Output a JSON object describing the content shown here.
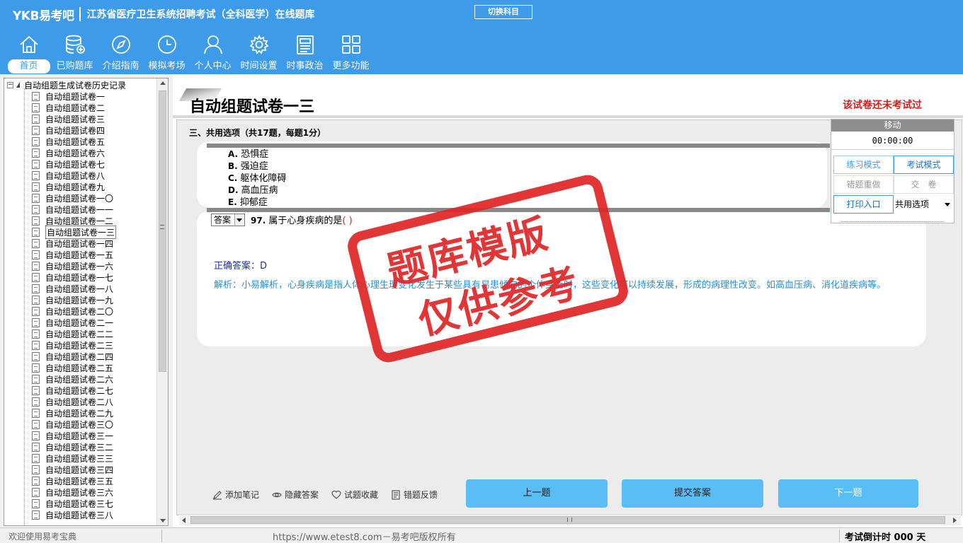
{
  "header": {
    "logo": "YKB易考吧",
    "title": "江苏省医疗卫生系统招聘考试（全科医学）在线题库",
    "switch_subject": "切换科目"
  },
  "nav": [
    {
      "label": "首页",
      "icon": "home-icon"
    },
    {
      "label": "已购题库",
      "icon": "database-icon"
    },
    {
      "label": "介绍指南",
      "icon": "compass-icon"
    },
    {
      "label": "模拟考场",
      "icon": "clock-icon"
    },
    {
      "label": "个人中心",
      "icon": "user-icon"
    },
    {
      "label": "时间设置",
      "icon": "gear-icon"
    },
    {
      "label": "时事政治",
      "icon": "news-icon"
    },
    {
      "label": "更多功能",
      "icon": "grid-icon"
    }
  ],
  "tree": {
    "root": "自动组题生成试卷历史记录",
    "items": [
      "自动组题试卷一",
      "自动组题试卷二",
      "自动组题试卷三",
      "自动组题试卷四",
      "自动组题试卷五",
      "自动组题试卷六",
      "自动组题试卷七",
      "自动组题试卷八",
      "自动组题试卷九",
      "自动组题试卷一〇",
      "自动组题试卷一一",
      "自动组题试卷一二",
      "自动组题试卷一三",
      "自动组题试卷一四",
      "自动组题试卷一五",
      "自动组题试卷一六",
      "自动组题试卷一七",
      "自动组题试卷一八",
      "自动组题试卷一九",
      "自动组题试卷二〇",
      "自动组题试卷二一",
      "自动组题试卷二二",
      "自动组题试卷二三",
      "自动组题试卷二四",
      "自动组题试卷二五",
      "自动组题试卷二六",
      "自动组题试卷二七",
      "自动组题试卷二八",
      "自动组题试卷二九",
      "自动组题试卷三〇",
      "自动组题试卷三一",
      "自动组题试卷三二",
      "自动组题试卷三三",
      "自动组题试卷三四",
      "自动组题试卷三五",
      "自动组题试卷三六",
      "自动组题试卷三七",
      "自动组题试卷三八"
    ],
    "selected_index": 12
  },
  "paper": {
    "title": "自动组题试卷一三",
    "status": "该试卷还未考试过",
    "section": "三、共用选项（共17题，每题1分）",
    "options": [
      {
        "key": "A.",
        "text": "恐惧症"
      },
      {
        "key": "B.",
        "text": "强迫症"
      },
      {
        "key": "C.",
        "text": "躯体化障碍"
      },
      {
        "key": "D.",
        "text": "高血压病"
      },
      {
        "key": "E.",
        "text": "抑郁症"
      }
    ],
    "answer_select": "答案",
    "question_no": "97.",
    "question": "属于心身疾病的是",
    "question_paren": "(  )",
    "correct_answer": "正确答案：D",
    "analysis": "解析：小易解析，心身疾病是指人体心理生理变化发生于某些具有易患倾向的个体身上时，这些变化可以持续发展，形成的病理性改变。如高血压病、消化道疾病等。"
  },
  "side_panel": {
    "move": "移动",
    "timer": "00:00:00",
    "practice_mode": "练习模式",
    "exam_mode": "考试模式",
    "redo_wrong": "错题重做",
    "submit_paper": "交　卷",
    "print_entry": "打印入口",
    "option_type": "共用选项"
  },
  "tools": {
    "add_note": "添加笔记",
    "hide_answer": "隐藏答案",
    "favorite": "试题收藏",
    "report_error": "错题反馈"
  },
  "buttons": {
    "prev": "上一题",
    "submit": "提交答案",
    "next": "下一题"
  },
  "watermark": {
    "line1": "题库模版",
    "line2": "仅供参考"
  },
  "statusbar": {
    "welcome": "欢迎使用易考宝典",
    "copyright": "https://www.etest8.com－易考吧版权所有",
    "countdown": "考试倒计时 000 天"
  },
  "colors": {
    "header_blue": "#3d9be9",
    "button_blue": "#5bbdf5",
    "status_red": "#d91c1c",
    "analysis_blue": "#2a8fd6"
  }
}
